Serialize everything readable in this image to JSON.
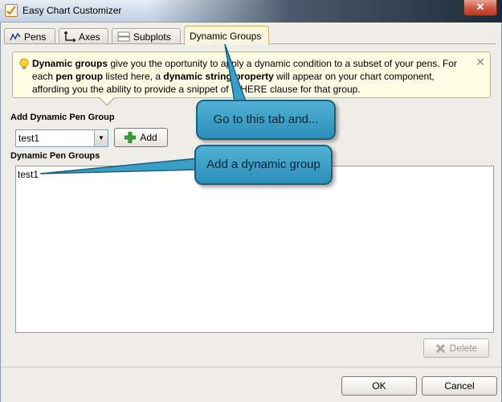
{
  "window": {
    "title": "Easy Chart Customizer",
    "close_symbol": "✕"
  },
  "tabs": [
    {
      "label": "Pens",
      "icon": "pens-line-icon"
    },
    {
      "label": "Axes",
      "icon": "axes-icon"
    },
    {
      "label": "Subplots",
      "icon": "subplots-icon"
    },
    {
      "label": "Dynamic Groups",
      "icon": null,
      "active": true
    }
  ],
  "info": {
    "icon": "lightbulb-icon",
    "part1_bold": "Dynamic groups",
    "part1": " give you the oportunity to apply a dynamic condition to a subset of your pens. For each ",
    "part2_bold": "pen group",
    "part2": " listed here, a ",
    "part3_bold": "dynamic string property",
    "part3": " will appear on your chart component, affording you the ability to provide a snippet of WHERE clause for that group.",
    "close_symbol": "✕"
  },
  "add_section": {
    "label": "Add Dynamic Pen Group",
    "combo_value": "test1",
    "add_label": "Add"
  },
  "groups_section": {
    "label": "Dynamic Pen Groups",
    "items": [
      "test1"
    ]
  },
  "delete_label": "Delete",
  "footer": {
    "ok_label": "OK",
    "cancel_label": "Cancel"
  },
  "callouts": {
    "tab_hint": "Go to this tab and...",
    "group_hint": "Add a dynamic group"
  },
  "colors": {
    "callout": "#3a9fc8",
    "active_tab": "#fbf5dd",
    "info_bg": "#fdfce4"
  }
}
